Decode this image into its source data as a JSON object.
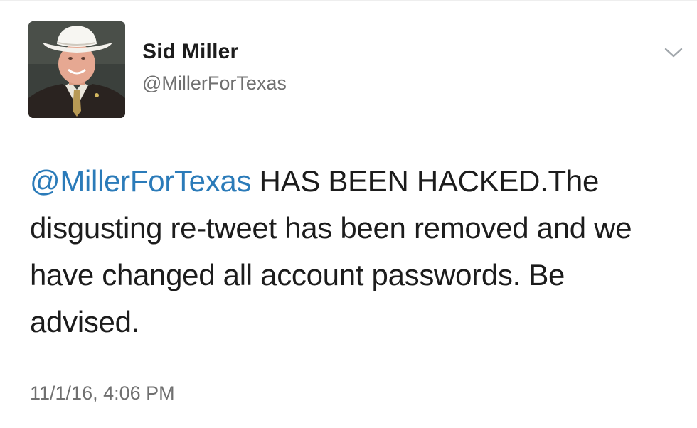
{
  "tweet": {
    "author_name": "Sid Miller",
    "author_handle": "@MillerForTexas",
    "avatar_icon": "profile-photo",
    "menu_icon": "chevron-down-icon",
    "mention": "@MillerForTexas",
    "text_after_mention": " HAS BEEN HACKED.The disgusting re-tweet has been removed and we have changed all account passwords.  Be advised.",
    "timestamp": "11/1/16, 4:06 PM"
  },
  "colors": {
    "mention": "#2b7bb9",
    "secondary_text": "#707070",
    "primary_text": "#1c1c1c"
  }
}
